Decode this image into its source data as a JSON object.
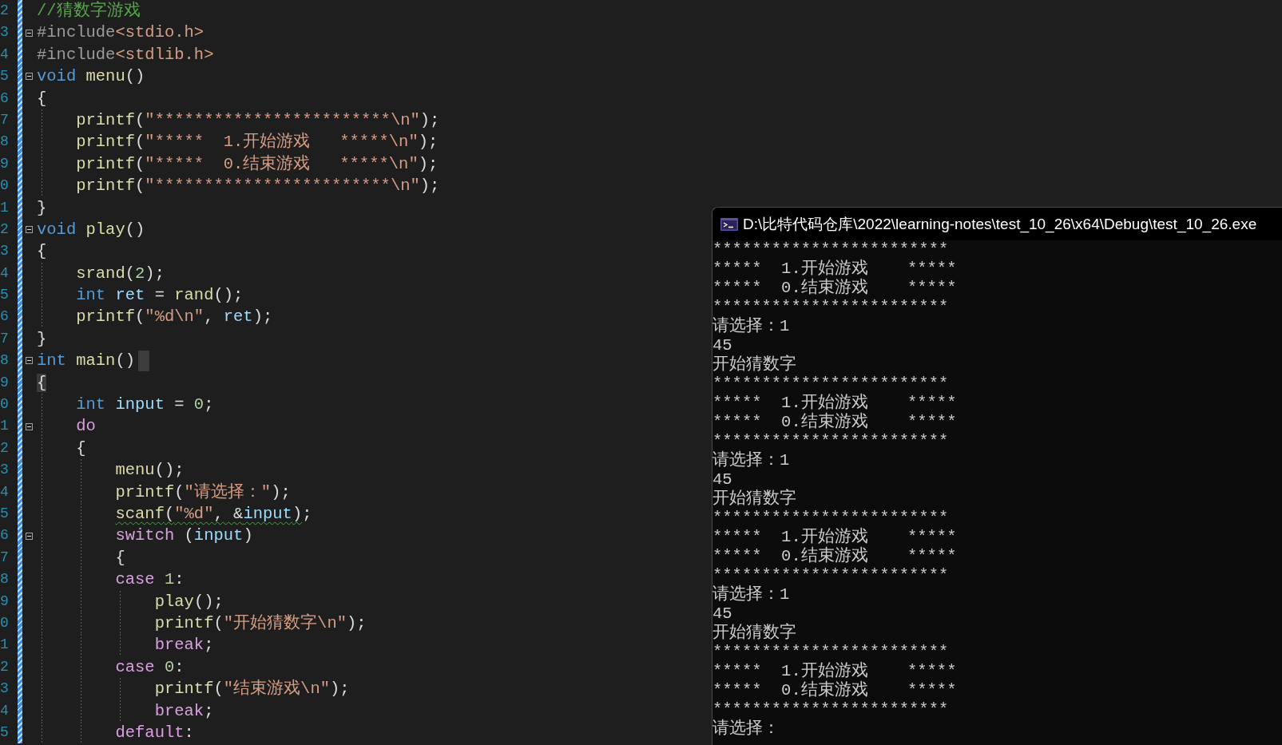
{
  "editor": {
    "lines": [
      {
        "number": "2",
        "fold": false,
        "squiggle": false,
        "cursor": false,
        "brace_match": false,
        "tokens": [
          {
            "kind": "comment",
            "text": "//猜数字游戏"
          }
        ]
      },
      {
        "number": "3",
        "fold": true,
        "squiggle": false,
        "cursor": false,
        "brace_match": false,
        "tokens": [
          {
            "kind": "pre",
            "text": "#include"
          },
          {
            "kind": "string",
            "text": "<stdio.h>"
          }
        ]
      },
      {
        "number": "4",
        "fold": false,
        "squiggle": false,
        "cursor": false,
        "brace_match": false,
        "tokens": [
          {
            "kind": "pre",
            "text": "#include"
          },
          {
            "kind": "string",
            "text": "<stdlib.h>"
          }
        ]
      },
      {
        "number": "5",
        "fold": true,
        "squiggle": false,
        "cursor": false,
        "brace_match": false,
        "tokens": [
          {
            "kind": "keyword",
            "text": "void"
          },
          {
            "kind": "func",
            "text": " menu"
          },
          {
            "kind": "plain",
            "text": "()"
          }
        ]
      },
      {
        "number": "6",
        "fold": false,
        "squiggle": false,
        "cursor": false,
        "brace_match": false,
        "tokens": [
          {
            "kind": "plain",
            "text": "{"
          }
        ]
      },
      {
        "number": "7",
        "fold": false,
        "squiggle": false,
        "cursor": false,
        "brace_match": false,
        "tokens": [
          {
            "kind": "func",
            "text": "    printf"
          },
          {
            "kind": "plain",
            "text": "("
          },
          {
            "kind": "string",
            "text": "\"************************\\n\""
          },
          {
            "kind": "plain",
            "text": ");"
          }
        ]
      },
      {
        "number": "8",
        "fold": false,
        "squiggle": false,
        "cursor": false,
        "brace_match": false,
        "tokens": [
          {
            "kind": "func",
            "text": "    printf"
          },
          {
            "kind": "plain",
            "text": "("
          },
          {
            "kind": "string",
            "text": "\"*****  1.开始游戏   *****\\n\""
          },
          {
            "kind": "plain",
            "text": ");"
          }
        ]
      },
      {
        "number": "9",
        "fold": false,
        "squiggle": false,
        "cursor": false,
        "brace_match": false,
        "tokens": [
          {
            "kind": "func",
            "text": "    printf"
          },
          {
            "kind": "plain",
            "text": "("
          },
          {
            "kind": "string",
            "text": "\"*****  0.结束游戏   *****\\n\""
          },
          {
            "kind": "plain",
            "text": ");"
          }
        ]
      },
      {
        "number": "0",
        "fold": false,
        "squiggle": false,
        "cursor": false,
        "brace_match": false,
        "tokens": [
          {
            "kind": "func",
            "text": "    printf"
          },
          {
            "kind": "plain",
            "text": "("
          },
          {
            "kind": "string",
            "text": "\"************************\\n\""
          },
          {
            "kind": "plain",
            "text": ");"
          }
        ]
      },
      {
        "number": "1",
        "fold": false,
        "squiggle": false,
        "cursor": false,
        "brace_match": false,
        "tokens": [
          {
            "kind": "plain",
            "text": "}"
          }
        ]
      },
      {
        "number": "2",
        "fold": true,
        "squiggle": false,
        "cursor": false,
        "brace_match": false,
        "tokens": [
          {
            "kind": "keyword",
            "text": "void"
          },
          {
            "kind": "func",
            "text": " play"
          },
          {
            "kind": "plain",
            "text": "()"
          }
        ]
      },
      {
        "number": "3",
        "fold": false,
        "squiggle": false,
        "cursor": false,
        "brace_match": false,
        "tokens": [
          {
            "kind": "plain",
            "text": "{"
          }
        ]
      },
      {
        "number": "4",
        "fold": false,
        "squiggle": false,
        "cursor": false,
        "brace_match": false,
        "tokens": [
          {
            "kind": "func",
            "text": "    srand"
          },
          {
            "kind": "plain",
            "text": "("
          },
          {
            "kind": "number",
            "text": "2"
          },
          {
            "kind": "plain",
            "text": ");"
          }
        ]
      },
      {
        "number": "5",
        "fold": false,
        "squiggle": false,
        "cursor": false,
        "brace_match": false,
        "tokens": [
          {
            "kind": "keyword",
            "text": "    int"
          },
          {
            "kind": "ident",
            "text": " ret"
          },
          {
            "kind": "plain",
            "text": " = "
          },
          {
            "kind": "func",
            "text": "rand"
          },
          {
            "kind": "plain",
            "text": "();"
          }
        ]
      },
      {
        "number": "6",
        "fold": false,
        "squiggle": false,
        "cursor": false,
        "brace_match": false,
        "tokens": [
          {
            "kind": "func",
            "text": "    printf"
          },
          {
            "kind": "plain",
            "text": "("
          },
          {
            "kind": "string",
            "text": "\"%d\\n\""
          },
          {
            "kind": "plain",
            "text": ", "
          },
          {
            "kind": "ident",
            "text": "ret"
          },
          {
            "kind": "plain",
            "text": ");"
          }
        ]
      },
      {
        "number": "7",
        "fold": false,
        "squiggle": false,
        "cursor": false,
        "brace_match": false,
        "tokens": [
          {
            "kind": "plain",
            "text": "}"
          }
        ]
      },
      {
        "number": "8",
        "fold": true,
        "squiggle": false,
        "cursor": true,
        "brace_match": false,
        "tokens": [
          {
            "kind": "keyword",
            "text": "int"
          },
          {
            "kind": "func",
            "text": " main"
          },
          {
            "kind": "plain",
            "text": "()"
          }
        ]
      },
      {
        "number": "9",
        "fold": false,
        "squiggle": false,
        "cursor": false,
        "brace_match": true,
        "tokens": [
          {
            "kind": "plain",
            "text": "{"
          }
        ]
      },
      {
        "number": "0",
        "fold": false,
        "squiggle": false,
        "cursor": false,
        "brace_match": false,
        "tokens": [
          {
            "kind": "keyword",
            "text": "    int"
          },
          {
            "kind": "ident",
            "text": " input"
          },
          {
            "kind": "plain",
            "text": " = "
          },
          {
            "kind": "number",
            "text": "0"
          },
          {
            "kind": "plain",
            "text": ";"
          }
        ]
      },
      {
        "number": "1",
        "fold": true,
        "squiggle": false,
        "cursor": false,
        "brace_match": false,
        "tokens": [
          {
            "kind": "control",
            "text": "    do"
          }
        ]
      },
      {
        "number": "2",
        "fold": false,
        "squiggle": false,
        "cursor": false,
        "brace_match": false,
        "tokens": [
          {
            "kind": "plain",
            "text": "    {"
          }
        ]
      },
      {
        "number": "3",
        "fold": false,
        "squiggle": false,
        "cursor": false,
        "brace_match": false,
        "tokens": [
          {
            "kind": "func",
            "text": "        menu"
          },
          {
            "kind": "plain",
            "text": "();"
          }
        ]
      },
      {
        "number": "4",
        "fold": false,
        "squiggle": false,
        "cursor": false,
        "brace_match": false,
        "tokens": [
          {
            "kind": "func",
            "text": "        printf"
          },
          {
            "kind": "plain",
            "text": "("
          },
          {
            "kind": "string",
            "text": "\"请选择：\""
          },
          {
            "kind": "plain",
            "text": ");"
          }
        ]
      },
      {
        "number": "5",
        "fold": false,
        "squiggle": true,
        "cursor": false,
        "brace_match": false,
        "tokens": [
          {
            "kind": "func",
            "text": "        scanf"
          },
          {
            "kind": "plain",
            "text": "("
          },
          {
            "kind": "string",
            "text": "\"%d\""
          },
          {
            "kind": "plain",
            "text": ", &"
          },
          {
            "kind": "ident",
            "text": "input"
          },
          {
            "kind": "plain",
            "text": ")"
          },
          {
            "kind": "plain",
            "text": ";"
          }
        ]
      },
      {
        "number": "6",
        "fold": true,
        "squiggle": false,
        "cursor": false,
        "brace_match": false,
        "tokens": [
          {
            "kind": "control",
            "text": "        switch"
          },
          {
            "kind": "plain",
            "text": " ("
          },
          {
            "kind": "ident",
            "text": "input"
          },
          {
            "kind": "plain",
            "text": ")"
          }
        ]
      },
      {
        "number": "7",
        "fold": false,
        "squiggle": false,
        "cursor": false,
        "brace_match": false,
        "tokens": [
          {
            "kind": "plain",
            "text": "        {"
          }
        ]
      },
      {
        "number": "8",
        "fold": false,
        "squiggle": false,
        "cursor": false,
        "brace_match": false,
        "tokens": [
          {
            "kind": "control",
            "text": "        case"
          },
          {
            "kind": "number",
            "text": " 1"
          },
          {
            "kind": "plain",
            "text": ":"
          }
        ]
      },
      {
        "number": "9",
        "fold": false,
        "squiggle": false,
        "cursor": false,
        "brace_match": false,
        "tokens": [
          {
            "kind": "func",
            "text": "            play"
          },
          {
            "kind": "plain",
            "text": "();"
          }
        ]
      },
      {
        "number": "0",
        "fold": false,
        "squiggle": false,
        "cursor": false,
        "brace_match": false,
        "tokens": [
          {
            "kind": "func",
            "text": "            printf"
          },
          {
            "kind": "plain",
            "text": "("
          },
          {
            "kind": "string",
            "text": "\"开始猜数字\\n\""
          },
          {
            "kind": "plain",
            "text": ");"
          }
        ]
      },
      {
        "number": "1",
        "fold": false,
        "squiggle": false,
        "cursor": false,
        "brace_match": false,
        "tokens": [
          {
            "kind": "control",
            "text": "            break"
          },
          {
            "kind": "plain",
            "text": ";"
          }
        ]
      },
      {
        "number": "2",
        "fold": false,
        "squiggle": false,
        "cursor": false,
        "brace_match": false,
        "tokens": [
          {
            "kind": "control",
            "text": "        case"
          },
          {
            "kind": "number",
            "text": " 0"
          },
          {
            "kind": "plain",
            "text": ":"
          }
        ]
      },
      {
        "number": "3",
        "fold": false,
        "squiggle": false,
        "cursor": false,
        "brace_match": false,
        "tokens": [
          {
            "kind": "func",
            "text": "            printf"
          },
          {
            "kind": "plain",
            "text": "("
          },
          {
            "kind": "string",
            "text": "\"结束游戏\\n\""
          },
          {
            "kind": "plain",
            "text": ");"
          }
        ]
      },
      {
        "number": "4",
        "fold": false,
        "squiggle": false,
        "cursor": false,
        "brace_match": false,
        "tokens": [
          {
            "kind": "control",
            "text": "            break"
          },
          {
            "kind": "plain",
            "text": ";"
          }
        ]
      },
      {
        "number": "5",
        "fold": false,
        "squiggle": false,
        "cursor": false,
        "brace_match": false,
        "tokens": [
          {
            "kind": "control",
            "text": "        default"
          },
          {
            "kind": "plain",
            "text": ":"
          }
        ]
      }
    ]
  },
  "console": {
    "title": "D:\\比特代码仓库\\2022\\learning-notes\\test_10_26\\x64\\Debug\\test_10_26.exe",
    "lines": [
      "************************",
      "*****  1.开始游戏    *****",
      "*****  0.结束游戏    *****",
      "************************",
      "请选择：1",
      "45",
      "开始猜数字",
      "************************",
      "*****  1.开始游戏    *****",
      "*****  0.结束游戏    *****",
      "************************",
      "请选择：1",
      "45",
      "开始猜数字",
      "************************",
      "*****  1.开始游戏    *****",
      "*****  0.结束游戏    *****",
      "************************",
      "请选择：1",
      "45",
      "开始猜数字",
      "************************",
      "*****  1.开始游戏    *****",
      "*****  0.结束游戏    *****",
      "************************",
      "请选择："
    ]
  }
}
